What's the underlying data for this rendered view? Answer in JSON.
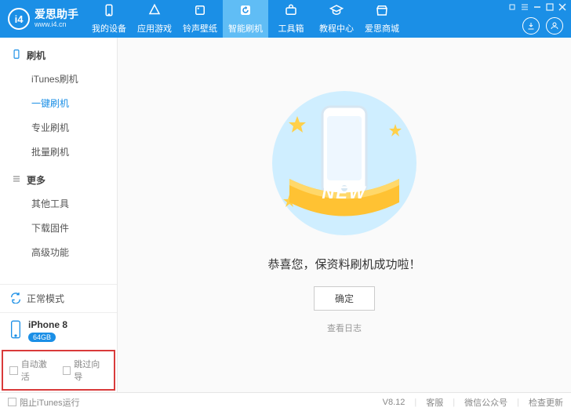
{
  "colors": {
    "accent": "#1b8fe6",
    "accent_light": "#60bdf5",
    "highlight_border": "#d93a3a"
  },
  "logo": {
    "mark": "i4",
    "title": "爱思助手",
    "url": "www.i4.cn"
  },
  "tabs": [
    {
      "key": "device",
      "label": "我的设备"
    },
    {
      "key": "apps",
      "label": "应用游戏"
    },
    {
      "key": "ring",
      "label": "铃声壁纸"
    },
    {
      "key": "flash",
      "label": "智能刷机"
    },
    {
      "key": "tools",
      "label": "工具箱"
    },
    {
      "key": "tutorial",
      "label": "教程中心"
    },
    {
      "key": "store",
      "label": "爱思商城"
    }
  ],
  "active_tab_index": 3,
  "sidebar": {
    "groups": [
      {
        "title": "刷机",
        "icon": "flash-icon",
        "items": [
          {
            "key": "itunes",
            "label": "iTunes刷机"
          },
          {
            "key": "oneclick",
            "label": "一键刷机",
            "active": true
          },
          {
            "key": "pro",
            "label": "专业刷机"
          },
          {
            "key": "batch",
            "label": "批量刷机"
          }
        ]
      },
      {
        "title": "更多",
        "icon": "list-icon",
        "items": [
          {
            "key": "other",
            "label": "其他工具"
          },
          {
            "key": "firmware",
            "label": "下载固件"
          },
          {
            "key": "advanced",
            "label": "高级功能"
          }
        ]
      }
    ],
    "status": {
      "label": "正常模式"
    },
    "device": {
      "name": "iPhone 8",
      "storage": "64GB"
    },
    "options": {
      "auto_activate": "自动激活",
      "skip_wizard": "跳过向导"
    }
  },
  "content": {
    "badge_text": "NEW",
    "message": "恭喜您，保资料刷机成功啦！",
    "confirm_label": "确定",
    "log_link": "查看日志"
  },
  "footer": {
    "block_itunes": "阻止iTunes运行",
    "version": "V8.12",
    "links": {
      "support": "客服",
      "wechat": "微信公众号",
      "update": "检查更新"
    }
  }
}
